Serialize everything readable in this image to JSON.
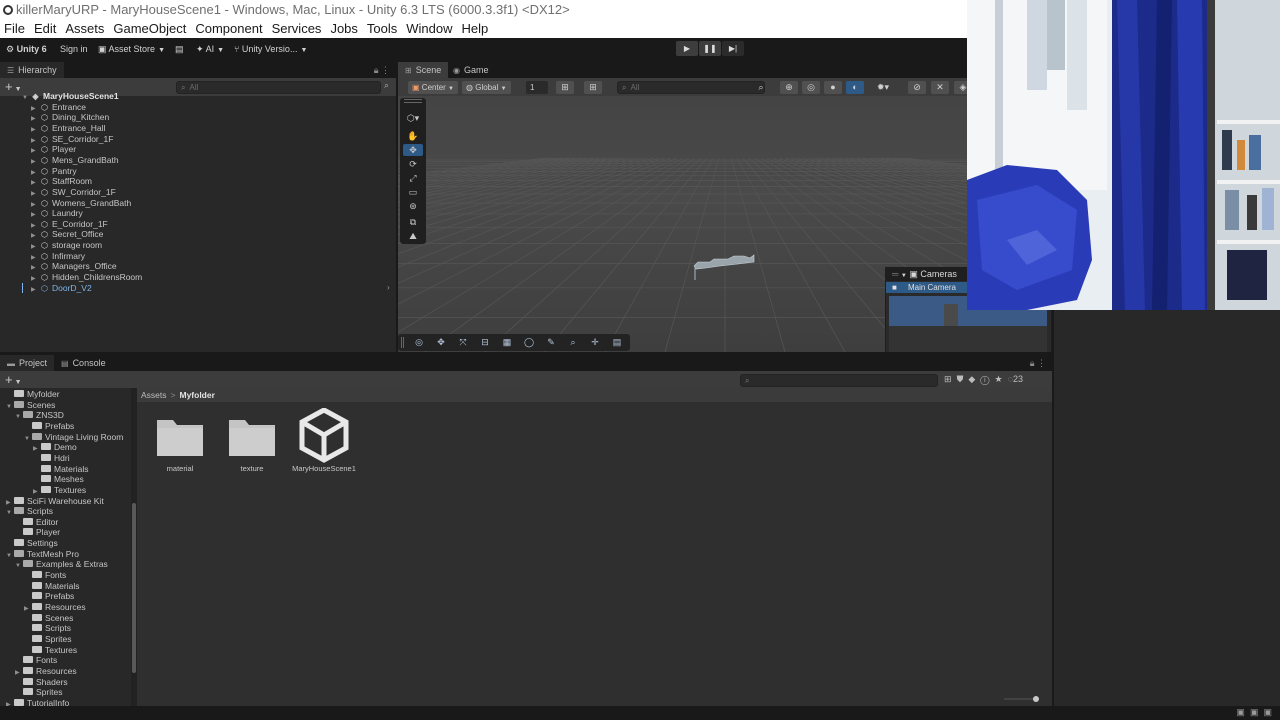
{
  "window": {
    "title": "killerMaryURP - MaryHouseScene1 - Windows, Mac, Linux - Unity 6.3 LTS (6000.3.3f1) <DX12>"
  },
  "menu": [
    "File",
    "Edit",
    "Assets",
    "GameObject",
    "Component",
    "Services",
    "Jobs",
    "Tools",
    "Window",
    "Help"
  ],
  "toolbar": {
    "unity": "Unity 6",
    "sign_in": "Sign in",
    "asset_store": "Asset Store",
    "ai": "AI",
    "version_control": "Unity Versio..."
  },
  "hierarchy": {
    "tab": "Hierarchy",
    "search_placeholder": "All",
    "scene_root": "MaryHouseScene1",
    "items": [
      "Entrance",
      "Dining_Kitchen",
      "Entrance_Hall",
      "SE_Corridor_1F",
      "Player",
      "Mens_GrandBath",
      "Pantry",
      "StaffRoom",
      "SW_Corridor_1F",
      "Womens_GrandBath",
      "Laundry",
      "E_Corridor_1F",
      "Secret_Office",
      "storage room",
      "Infirmary",
      "Managers_Office",
      "Hidden_ChildrensRoom"
    ],
    "prefab_item": "DoorD_V2"
  },
  "scene": {
    "tabs": [
      "Scene",
      "Game"
    ],
    "pivot": "Center",
    "space": "Global",
    "snap_value": "1",
    "search_placeholder": "All",
    "cameras_title": "Cameras",
    "main_camera": "Main Camera"
  },
  "project": {
    "tabs": [
      "Project",
      "Console"
    ],
    "item_count": "23",
    "breadcrumb": [
      "Assets",
      "Myfolder"
    ],
    "tree": [
      {
        "label": "Myfolder",
        "depth": 1,
        "arrow": "",
        "open": false
      },
      {
        "label": "Scenes",
        "depth": 1,
        "arrow": "▼",
        "open": true
      },
      {
        "label": "ZNS3D",
        "depth": 2,
        "arrow": "▼",
        "open": true
      },
      {
        "label": "Prefabs",
        "depth": 3,
        "arrow": "",
        "open": false
      },
      {
        "label": "Vintage Living Room",
        "depth": 3,
        "arrow": "▼",
        "open": true
      },
      {
        "label": "Demo",
        "depth": 4,
        "arrow": "▶",
        "open": false
      },
      {
        "label": "Hdri",
        "depth": 4,
        "arrow": "",
        "open": false
      },
      {
        "label": "Materials",
        "depth": 4,
        "arrow": "",
        "open": false
      },
      {
        "label": "Meshes",
        "depth": 4,
        "arrow": "",
        "open": false
      },
      {
        "label": "Textures",
        "depth": 4,
        "arrow": "▶",
        "open": false
      },
      {
        "label": "SciFi Warehouse Kit",
        "depth": 1,
        "arrow": "▶",
        "open": false
      },
      {
        "label": "Scripts",
        "depth": 1,
        "arrow": "▼",
        "open": true
      },
      {
        "label": "Editor",
        "depth": 2,
        "arrow": "",
        "open": false
      },
      {
        "label": "Player",
        "depth": 2,
        "arrow": "",
        "open": false
      },
      {
        "label": "Settings",
        "depth": 1,
        "arrow": "",
        "open": false
      },
      {
        "label": "TextMesh Pro",
        "depth": 1,
        "arrow": "▼",
        "open": true
      },
      {
        "label": "Examples & Extras",
        "depth": 2,
        "arrow": "▼",
        "open": true
      },
      {
        "label": "Fonts",
        "depth": 3,
        "arrow": "",
        "open": false
      },
      {
        "label": "Materials",
        "depth": 3,
        "arrow": "",
        "open": false
      },
      {
        "label": "Prefabs",
        "depth": 3,
        "arrow": "",
        "open": false
      },
      {
        "label": "Resources",
        "depth": 3,
        "arrow": "▶",
        "open": false
      },
      {
        "label": "Scenes",
        "depth": 3,
        "arrow": "",
        "open": false
      },
      {
        "label": "Scripts",
        "depth": 3,
        "arrow": "",
        "open": false
      },
      {
        "label": "Sprites",
        "depth": 3,
        "arrow": "",
        "open": false
      },
      {
        "label": "Textures",
        "depth": 3,
        "arrow": "",
        "open": false
      },
      {
        "label": "Fonts",
        "depth": 2,
        "arrow": "",
        "open": false
      },
      {
        "label": "Resources",
        "depth": 2,
        "arrow": "▶",
        "open": false
      },
      {
        "label": "Shaders",
        "depth": 2,
        "arrow": "",
        "open": false
      },
      {
        "label": "Sprites",
        "depth": 2,
        "arrow": "",
        "open": false
      },
      {
        "label": "TutorialInfo",
        "depth": 1,
        "arrow": "▶",
        "open": false
      }
    ],
    "assets": [
      {
        "label": "material",
        "icon": "folder-icon"
      },
      {
        "label": "texture",
        "icon": "folder-icon"
      },
      {
        "label": "MaryHouseScene1",
        "icon": "unity-scene-icon"
      }
    ]
  },
  "colors": {
    "accent": "#2d5a86",
    "prefab": "#7eb4ea",
    "panel": "#282828",
    "scene_bg": "#494949"
  }
}
